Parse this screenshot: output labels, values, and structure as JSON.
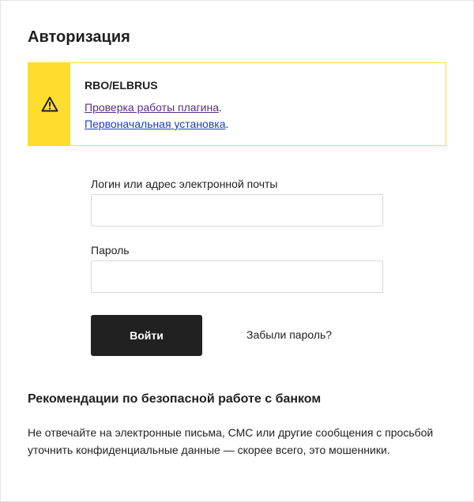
{
  "header": {
    "title": "Авторизация"
  },
  "notice": {
    "title": "RBO/ELBRUS",
    "link_check": "Проверка работы плагина",
    "link_install": "Первоначальная установка",
    "punct": ".",
    "icon": "warning-icon",
    "accent_color": "#ffdd2d"
  },
  "form": {
    "login_label": "Логин или адрес электронной почты",
    "login_value": "",
    "password_label": "Пароль",
    "password_value": "",
    "submit_label": "Войти",
    "forgot_label": "Забыли пароль?"
  },
  "recommendations": {
    "title": "Рекомендации по безопасной работе с банком",
    "text": "Не отвечайте на электронные письма, СМС или другие сообщения с просьбой уточнить конфиденциальные данные — скорее всего, это мошенники."
  }
}
